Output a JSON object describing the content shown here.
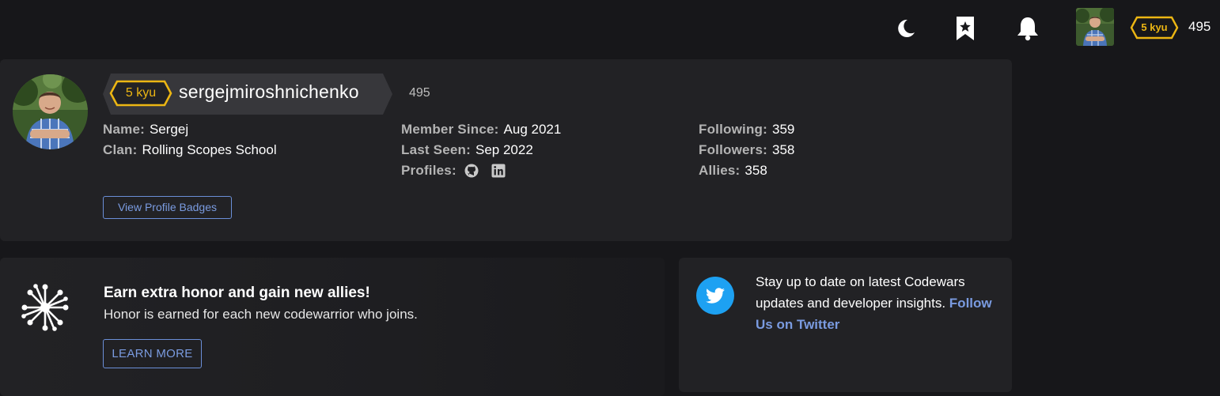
{
  "header": {
    "icons": [
      "moon-icon",
      "bookmark-star-icon",
      "bell-icon"
    ],
    "rank": "5 kyu",
    "honor": "495"
  },
  "profile": {
    "rank": "5 kyu",
    "username": "sergejmiroshnichenko",
    "honor": "495",
    "col1": [
      {
        "label": "Name:",
        "value": "Sergej"
      },
      {
        "label": "Clan:",
        "value": "Rolling Scopes School"
      }
    ],
    "col2": [
      {
        "label": "Member Since:",
        "value": "Aug 2021"
      },
      {
        "label": "Last Seen:",
        "value": "Sep 2022"
      },
      {
        "label": "Profiles:",
        "value": ""
      }
    ],
    "col3": [
      {
        "label": "Following:",
        "value": "359"
      },
      {
        "label": "Followers:",
        "value": "358"
      },
      {
        "label": "Allies:",
        "value": "358"
      }
    ],
    "profile_icons": [
      "github-icon",
      "linkedin-icon"
    ],
    "badges_button": "View Profile Badges"
  },
  "honor_promo": {
    "title": "Earn extra honor and gain new allies!",
    "subtitle": "Honor is earned for each new codewarrior who joins.",
    "button": "LEARN MORE"
  },
  "twitter_promo": {
    "text": "Stay up to date on latest Codewars updates and developer insights.",
    "link": "Follow Us on Twitter"
  },
  "colors": {
    "rank_yellow": "#ecb613",
    "link_blue": "#7a9be0",
    "twitter_blue": "#1da1f2",
    "card_bg": "#222225",
    "page_bg": "#17171a"
  }
}
